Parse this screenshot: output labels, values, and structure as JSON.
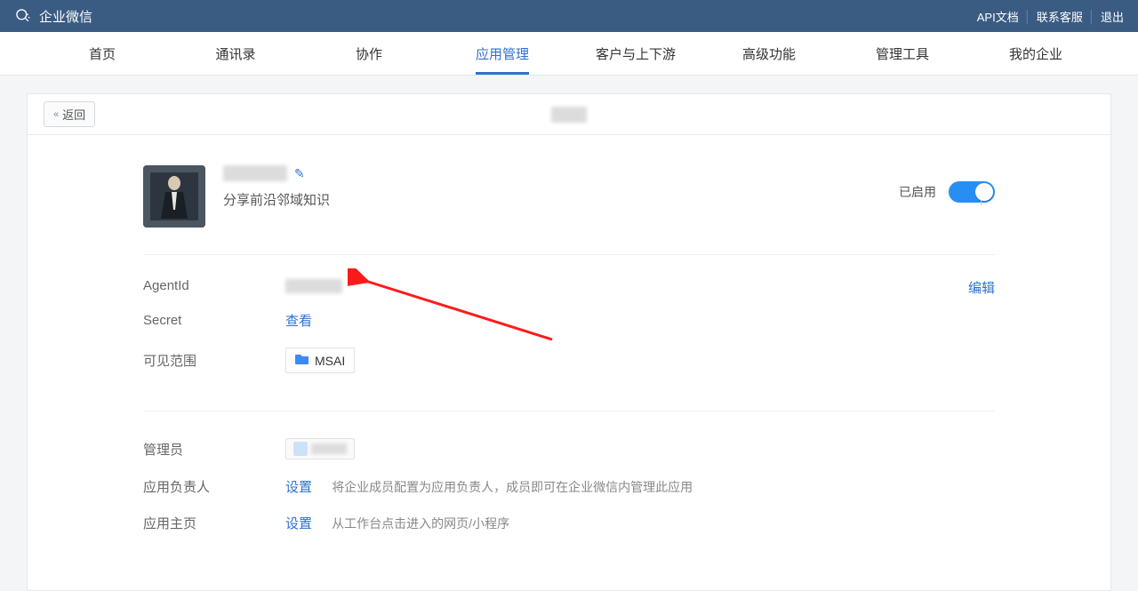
{
  "header": {
    "brand": "企业微信",
    "links": {
      "api": "API文档",
      "support": "联系客服",
      "logout": "退出"
    }
  },
  "nav": {
    "items": [
      "首页",
      "通讯录",
      "协作",
      "应用管理",
      "客户与上下游",
      "高级功能",
      "管理工具",
      "我的企业"
    ],
    "active_index": 3
  },
  "panel": {
    "back": "返回"
  },
  "app": {
    "desc": "分享前沿邻域知识",
    "enabled_label": "已启用"
  },
  "info": {
    "agent_id_label": "AgentId",
    "secret_label": "Secret",
    "secret_action": "查看",
    "scope_label": "可见范围",
    "scope_value": "MSAI",
    "edit": "编辑"
  },
  "mgmt": {
    "admin_label": "管理员",
    "owner_label": "应用负责人",
    "owner_action": "设置",
    "owner_hint": "将企业成员配置为应用负责人，成员即可在企业微信内管理此应用",
    "home_label": "应用主页",
    "home_action": "设置",
    "home_hint": "从工作台点击进入的网页/小程序"
  }
}
